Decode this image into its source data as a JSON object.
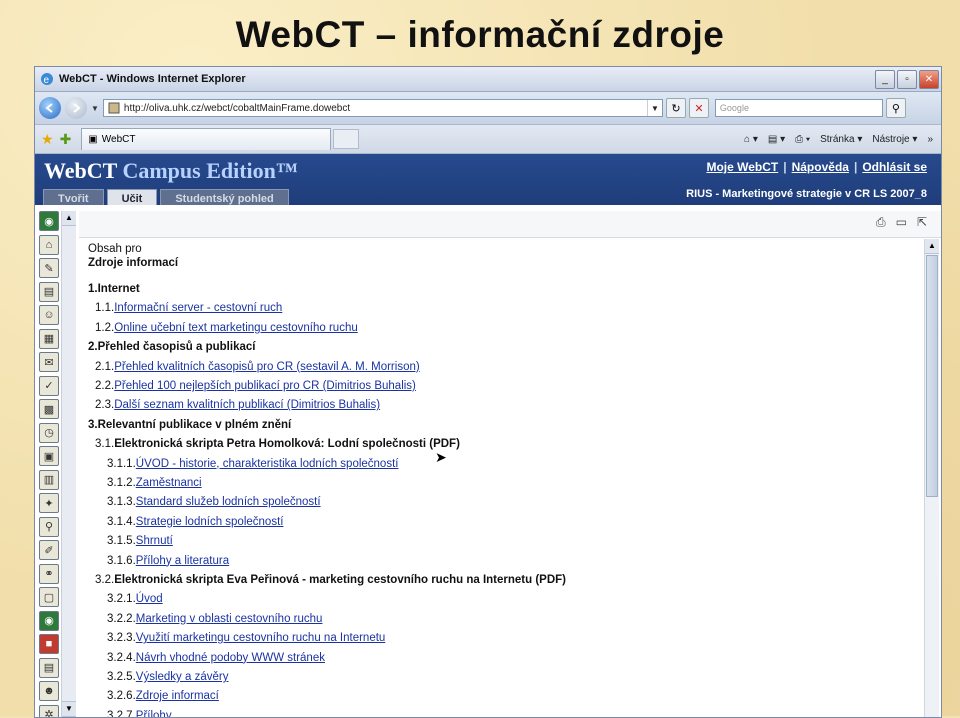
{
  "slide": {
    "title": "WebCT – informační zdroje"
  },
  "browser": {
    "window_title": "WebCT - Windows Internet Explorer",
    "address": "http://oliva.uhk.cz/webct/cobaltMainFrame.dowebct",
    "search_placeholder": "Google",
    "tab_label": "WebCT",
    "page_menu": "Stránka",
    "tools_menu": "Nástroje"
  },
  "webct": {
    "logo_main": "WebCT",
    "logo_edition": "Campus Edition™",
    "links": [
      "Moje WebCT",
      "Nápověda",
      "Odhlásit se"
    ],
    "course": "RIUS - Marketingové strategie v CR LS 2007_8",
    "tabs": [
      "Tvořit",
      "Učit",
      "Studentský pohled"
    ],
    "active_tab": "Učit"
  },
  "content": {
    "breadcrumb": "Obsah pro",
    "heading": "Zdroje informací",
    "items": [
      {
        "num": "1.",
        "text": "Internet",
        "link": false,
        "bold": true,
        "indent": 0
      },
      {
        "num": "1.1.",
        "text": "Informační server - cestovní ruch",
        "link": true,
        "bold": false,
        "indent": 1
      },
      {
        "num": "1.2.",
        "text": "Online učební text marketingu cestovního ruchu",
        "link": true,
        "bold": false,
        "indent": 1
      },
      {
        "num": "2.",
        "text": "Přehled časopisů a publikací",
        "link": false,
        "bold": true,
        "indent": 0
      },
      {
        "num": "2.1.",
        "text": "Přehled kvalitních časopisů pro CR (sestavil A. M. Morrison)",
        "link": true,
        "bold": false,
        "indent": 1
      },
      {
        "num": "2.2.",
        "text": "Přehled 100 nejlepších publikací pro CR (Dimitrios Buhalis)",
        "link": true,
        "bold": false,
        "indent": 1
      },
      {
        "num": "2.3.",
        "text": "Další seznam kvalitních publikací (Dimitrios Buhalis)",
        "link": true,
        "bold": false,
        "indent": 1
      },
      {
        "num": "3.",
        "text": "Relevantní publikace v plném znění",
        "link": false,
        "bold": true,
        "indent": 0
      },
      {
        "num": "3.1.",
        "text": "Elektronická skripta Petra Homolková: Lodní společnosti (PDF)",
        "link": false,
        "bold": true,
        "indent": 1
      },
      {
        "num": "3.1.1.",
        "text": "ÚVOD - historie, charakteristika lodních společností",
        "link": true,
        "bold": false,
        "indent": 2
      },
      {
        "num": "3.1.2.",
        "text": "Zaměstnanci",
        "link": true,
        "bold": false,
        "indent": 2
      },
      {
        "num": "3.1.3.",
        "text": "Standard služeb lodních společností",
        "link": true,
        "bold": false,
        "indent": 2
      },
      {
        "num": "3.1.4.",
        "text": "Strategie lodních společností",
        "link": true,
        "bold": false,
        "indent": 2
      },
      {
        "num": "3.1.5.",
        "text": "Shrnutí",
        "link": true,
        "bold": false,
        "indent": 2
      },
      {
        "num": "3.1.6.",
        "text": "Přílohy a literatura",
        "link": true,
        "bold": false,
        "indent": 2
      },
      {
        "num": "3.2.",
        "text": "Elektronická skripta Eva Peřinová - marketing cestovního ruchu na Internetu (PDF)",
        "link": false,
        "bold": true,
        "indent": 1
      },
      {
        "num": "3.2.1.",
        "text": "Úvod",
        "link": true,
        "bold": false,
        "indent": 2
      },
      {
        "num": "3.2.2.",
        "text": "Marketing v oblasti cestovního ruchu",
        "link": true,
        "bold": false,
        "indent": 2
      },
      {
        "num": "3.2.3.",
        "text": "Využití marketingu cestovního ruchu na Internetu",
        "link": true,
        "bold": false,
        "indent": 2
      },
      {
        "num": "3.2.4.",
        "text": "Návrh vhodné podoby WWW stránek",
        "link": true,
        "bold": false,
        "indent": 2
      },
      {
        "num": "3.2.5.",
        "text": "Výsledky a závěry",
        "link": true,
        "bold": false,
        "indent": 2
      },
      {
        "num": "3.2.6.",
        "text": "Zdroje informací",
        "link": true,
        "bold": false,
        "indent": 2
      },
      {
        "num": "3.2.7.",
        "text": "Přílohy",
        "link": true,
        "bold": false,
        "indent": 2
      }
    ]
  }
}
